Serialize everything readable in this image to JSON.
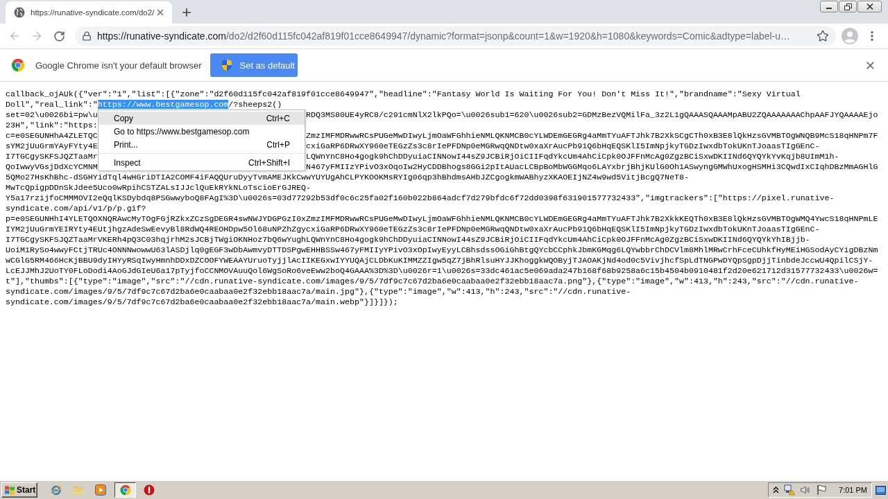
{
  "tabs": [
    {
      "title": "https://runative-syndicate.com/do2/",
      "selected": true
    }
  ],
  "navigation": {
    "back": {
      "disabled": true
    },
    "forward": {
      "disabled": true
    }
  },
  "address_bar": {
    "host": "https://runative-syndicate.com",
    "path": "/do2/d2f60d115fc042af819f01cce8649947/dynamic?format=jsonp&count=1&w=1920&h=1080&keywords=Comic&adtype=label-u…"
  },
  "infobar": {
    "message": "Google Chrome isn't your default browser",
    "button": "Set as default"
  },
  "document": {
    "lines": [
      {
        "text": "callback_ojAUk({\"ver\":\"1\",\"list\":[{\"zone\":\"d2f60d115fc042af819f01cce8649947\",\"headline\":\"Fantasy World Is Waiting For You! Don't Miss It!\",\"brandname\":\"Sexy Virtual"
      },
      {
        "text": "Doll\",\"real_link\":\"",
        "selection": "https://www.bestgamesop.com",
        "after_selection": "/?sheeps2()"
      },
      {
        "text": "set=02\\u0026bi=pw\\u",
        "right": "RDQ3MS80UE4yRC8/c291cmNlX2lkPQo=\\u0026sub1=620\\u0026sub2=GDMzBezVQMilFa_3z2L1gQAAASQAAAMpABU2ZQAAAAAAAChpAAFJYQAAAAEjo"
      },
      {
        "text": "23H\",\"link\":\"https:"
      },
      {
        "text": "c=e0SEGUNHhA4ZLETQC",
        "right": "ZmzIMFMDRwwRCsPUGeMwDIwyLjmOaWFGhhieNMLQKNMCB0cYLWDEmGEGRg4aMmTYuAFTJhk7B2XkSCgCTh0xB3E8lQkHzsGVMBTOgWNQB9McS18qHNPm7F"
      },
      {
        "text": "sYM2jUuGrmYAyFYty4E",
        "right": "cxiGaRP6DRwXY960eTEGzZs3c8rIePFDNp0eMGRwqQNDtw0xaXrAucPb91Q6bHqEQSKlI5ImNpjkyTGDzIwxdbTokUKnTJoaasTIgGEnC-"
      },
      {
        "text": "I7TGCgySKFSJQZTaaMr",
        "right": "LQWnYnC8Ho4gogk9hChDDyuiaCINNowI44sZ9JCBiRjOiCIIFqdYkcUm4AhCiCpk0OJFFnMcAg0ZgzBCiSxwDKIINd6QYQYkYvKqjb8UImM1h-"
      },
      {
        "text": "QoIwwyVGsjDdXcYCMNM",
        "right": "N467yFMIIzYPivO3xOqoIw2HyCDDBhogs8GGi2pItAUacLCBpBoMbWGGMqo6LAYxbrjBhjKUlG0Oh1ASwyngGMWhUxogHSMHi3CQwdIxCIqhDBzMmAGHlG"
      },
      {
        "text": "5QMo27HsKhBhc-dSGHYidTql4wHGriDTIA2COMF4iFAQQUruDyyTvmAMEJKkCwwYUYUgAhCLPYKOOKMsRYIg06qp3hBhdmsAHbJZCgogkmWABhyzXKAOEIjNZ4w9wd5VitjBcgQ7NeT8-"
      },
      {
        "text": "MwTcQpigpDDnSkJdee5Uco0wRpihCSTZALsIJJclQuEkRYkNLoTscioErGJREQ-"
      },
      {
        "text": "Y5a17rzijfoCMMMOVI2eQqlKSDybdq8PSGwwyboQ8FAgI%3D\\u0026s=03d77292b53df0c6c25fa02f160b022b864adcf7d279bfdc6f72dd0398f631901577732433\",\"imgtrackers\":[\"https://pixel.runative-"
      },
      {
        "text": "syndicate.com/api/v1/p/p.gif?"
      },
      {
        "text": "p=e0SEGUNHhI4YLETQOXNQRAwcMyTOgFGjRZkxZCzSgDEGR4swNWJYDGPGzI0xZmzIMFMDRwwRCsPUGeMwDIwyLjmOaWFGhhieNMLQKNMCB0cYLWDEmGEGRg4aMmTYuAFTJhk7B2XkkKEQTh0xB3E8lQkHzsGVMBTOgWMQ4YwcS18qHNPmLE"
      },
      {
        "text": "IYM2jUuGrmYEIRYty4EUtjhgzAdeSwEevyBl8RdWQ4REOHDpw5Ol68uNPZhZgycxiGaRP6DRwXY960eTEGzZs3c8rIePFDNp0eMGRwqQNDtw0xaXrAucPb91Q6bHqEQSKlI5ImNpjkyTGDzIwxdbTokUKnTJoaasTIgGEnC-"
      },
      {
        "text": "I7TGCgySKFSJQZTaaMrVKERh4pQ3C03hqjrhM2sJCBjTWgiOKNHoz7bQ6wYughLQWnYnC8Ho4gogk9hChDDyuiaCINNowI44sZ9JCBiRjOiCIIFqdYkcUm4AhCiCpk0OJFFnMcAg0ZgzBCiSxwDKIINd6QYQYkYhIBjjb-"
      },
      {
        "text": "UoiM1RySo4wwyFCtjTRUc4ONNNwowwU63lASDjlq0gEGF3wDbAwmvyDTTDSPgwEHHBSSw467yFMIIyYPivO3xOpIwyEyyLCBhsdssOGiGhBtgQYcbCCphkJbmKGMqg6LQYwbbrChDCVlm8MhlMRwCrhFceCUhkfHyMEiHGSodAyCYigDBzNm"
      },
      {
        "text": "wCGlG5RM466HcKjBBU9dyIHYyRSqIwyHmnhDDxDZCOOFYWEAAYUruoTyjjlAcIIKEGxwIYYUQAjCLDbKuKIMMZZIgw5qZ7jBhRlsuHYJJKhoggkWQOByjTJAOAKjNd4od0c5VivjhcfSpLdTNGPwDYQpSgpDjjTinbdeJccwU4QpilCSjY-"
      },
      {
        "text": "LcEJJMhJ2UoTY0FLoDodi4AoGJdGIeU6a17pTyjfoCCNMOVAuuQol6WgSoRo6veEww2boQ4GAAA%3D%3D\\u0026r=1\\u0026s=33dc461ac5e069ada247b168f68b9258a6c15b4504b0910481f2d20e621712d31577732433\\u0026w="
      },
      {
        "text": "t\"],\"thumbs\":[{\"type\":\"image\",\"src\":\"//cdn.runative-syndicate.com/images/9/5/7df9c7c67d2ba6e0caabaa0e2f32ebb18aac7a.png\"},{\"type\":\"image\",\"w\":413,\"h\":243,\"src\":\"//cdn.runative-"
      },
      {
        "text": "syndicate.com/images/9/5/7df9c7c67d2ba6e0caabaa0e2f32ebb18aac7a/main.jpg\"},{\"type\":\"image\",\"w\":413,\"h\":243,\"src\":\"//cdn.runative-"
      },
      {
        "text": "syndicate.com/images/9/5/7df9c7c67d2ba6e0caabaa0e2f32ebb18aac7a/main.webp\"}]}]});"
      }
    ]
  },
  "context_menu": {
    "items": [
      {
        "kind": "item",
        "label": "Copy",
        "shortcut": "Ctrl+C",
        "selected": true
      },
      {
        "kind": "item",
        "label": "Go to https://www.bestgamesop.com",
        "selected": false
      },
      {
        "kind": "item",
        "label": "Print...",
        "shortcut": "Ctrl+P",
        "selected": false
      },
      {
        "kind": "separator"
      },
      {
        "kind": "item",
        "label": "Inspect",
        "shortcut": "Ctrl+Shift+I",
        "selected": false
      }
    ]
  },
  "taskbar": {
    "start": "Start",
    "tasks": [
      {
        "selected": true
      },
      {
        "selected": false
      }
    ],
    "clock": "7:01 PM"
  }
}
